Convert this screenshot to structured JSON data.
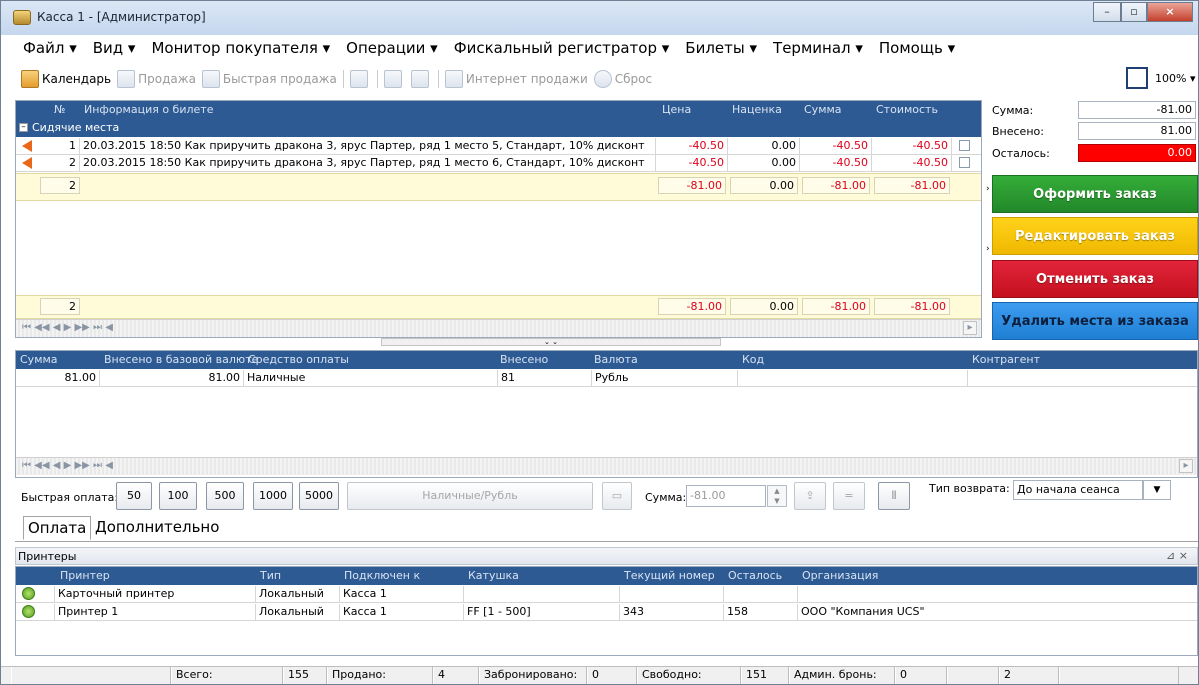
{
  "window": {
    "title": "Касса 1 - [Администратор]"
  },
  "menu": [
    "Файл ▾",
    "Вид ▾",
    "Монитор покупателя ▾",
    "Операции ▾",
    "Фискальный регистратор ▾",
    "Билеты ▾",
    "Терминал ▾",
    "Помощь ▾"
  ],
  "toolbar": {
    "calendar": "Календарь",
    "sale": "Продажа",
    "quick_sale": "Быстрая продажа",
    "internet_sales": "Интернет продажи",
    "reset": "Сброс",
    "zoom": "100% ▾"
  },
  "tickets": {
    "headers": {
      "num": "№",
      "info": "Информация о билете",
      "price": "Цена",
      "markup": "Наценка",
      "sum": "Сумма",
      "cost": "Стоимость"
    },
    "group": "Сидячие места",
    "rows": [
      {
        "num": "1",
        "info": "20.03.2015 18:50 Как приручить дракона 3, ярус Партер, ряд 1 место 5, Стандарт, 10% дисконт",
        "price": "-40.50",
        "markup": "0.00",
        "sum": "-40.50",
        "cost": "-40.50"
      },
      {
        "num": "2",
        "info": "20.03.2015 18:50 Как приручить дракона 3, ярус Партер, ряд 1 место 6, Стандарт, 10% дисконт",
        "price": "-40.50",
        "markup": "0.00",
        "sum": "-40.50",
        "cost": "-40.50"
      }
    ],
    "group_total": {
      "count": "2",
      "price": "-81.00",
      "markup": "0.00",
      "sum": "-81.00",
      "cost": "-81.00"
    },
    "footer_total": {
      "count": "2",
      "price": "-81.00",
      "markup": "0.00",
      "sum": "-81.00",
      "cost": "-81.00"
    }
  },
  "summary": {
    "sum_label": "Сумма:",
    "sum": "-81.00",
    "paid_label": "Внесено:",
    "paid": "81.00",
    "left_label": "Осталось:",
    "left": "0.00"
  },
  "actions": {
    "place_order": "Оформить заказ",
    "edit_order": "Редактировать заказ",
    "cancel_order": "Отменить заказ",
    "remove_seats": "Удалить места из заказа"
  },
  "payments": {
    "headers": {
      "sum": "Сумма",
      "base": "Внесено в базовой валюте",
      "method": "Средство оплаты",
      "paid": "Внесено",
      "currency": "Валюта",
      "code": "Код",
      "counterparty": "Контрагент"
    },
    "rows": [
      {
        "sum": "81.00",
        "base": "81.00",
        "method": "Наличные",
        "paid": "81",
        "currency": "Рубль",
        "code": "",
        "counterparty": ""
      }
    ]
  },
  "quickpay": {
    "label": "Быстрая оплата:",
    "amounts": [
      "50",
      "100",
      "500",
      "1000",
      "5000"
    ],
    "cash": "Наличные/Рубль",
    "sum_label": "Сумма:",
    "sum": "-81.00",
    "return_label": "Тип возврата:",
    "return_type": "До начала сеанса"
  },
  "tabs": [
    "Оплата",
    "Дополнительно"
  ],
  "printers": {
    "panel_title": "Принтеры",
    "pin": "⊿ ×",
    "headers": {
      "printer": "Принтер",
      "type": "Тип",
      "connected": "Подключен к",
      "roll": "Катушка",
      "current": "Текущий номер",
      "left": "Осталось",
      "org": "Организация"
    },
    "rows": [
      {
        "printer": "Карточный принтер",
        "type": "Локальный",
        "connected": "Касса 1",
        "roll": "",
        "current": "",
        "left": "",
        "org": ""
      },
      {
        "printer": "Принтер 1",
        "type": "Локальный",
        "connected": "Касса 1",
        "roll": "FF [1 - 500]",
        "current": "343",
        "left": "158",
        "org": "ООО \"Компания UCS\""
      }
    ]
  },
  "status": {
    "total_label": "Всего:",
    "total": "155",
    "sold_label": "Продано:",
    "sold": "4",
    "reserved_label": "Забронировано:",
    "reserved": "0",
    "free_label": "Свободно:",
    "free": "151",
    "admin_label": "Админ. бронь:",
    "admin": "0",
    "extra": "2"
  },
  "colors": {
    "header": "#2d5a93",
    "place": "#2e9e32",
    "edit": "#f5c200",
    "cancel": "#d7182a",
    "remove": "#2a8fe0",
    "left_bg": "#ff0000"
  }
}
